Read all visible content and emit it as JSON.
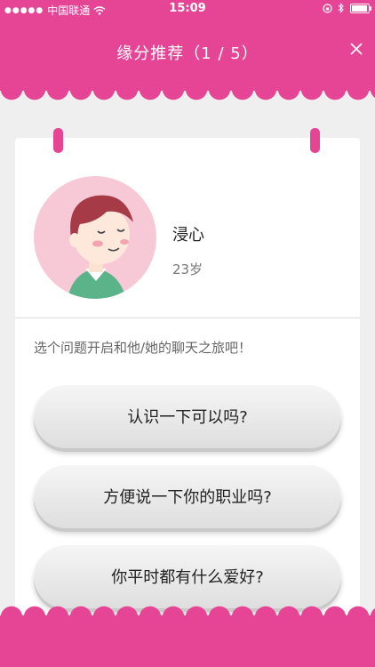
{
  "status_bar": {
    "carrier": "中国联通",
    "time": "15:09"
  },
  "header": {
    "title": "缘分推荐（1 / 5）",
    "close_icon": "close-icon"
  },
  "profile": {
    "name": "浸心",
    "age": "23岁"
  },
  "prompt": "选个问题开启和他/她的聊天之旅吧！",
  "questions": [
    {
      "label": "认识一下可以吗?"
    },
    {
      "label": "方便说一下你的职业吗?"
    },
    {
      "label": "你平时都有什么爱好?"
    }
  ],
  "colors": {
    "accent": "#e64596",
    "background": "#efefef",
    "card": "#ffffff"
  }
}
